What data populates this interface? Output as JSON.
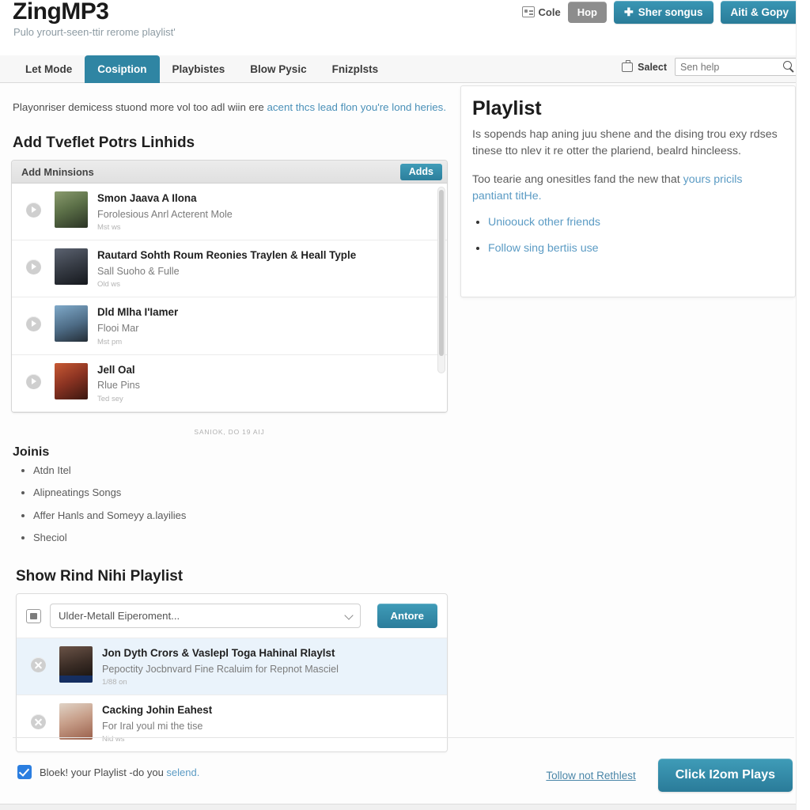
{
  "header": {
    "brand": "ZingMP3",
    "tagline": "Pulo yrourt-seen-ttir rerome playlist'",
    "chip_label": "Cole",
    "chip_icon": "card-icon",
    "btn_hop": "Hop",
    "btn_share": "Sher songus",
    "btn_share_icon": "plus-icon",
    "btn_copy": "Aiti & Gopy"
  },
  "nav": {
    "tabs": [
      {
        "label": "Let Mode",
        "active": false
      },
      {
        "label": "Cosiption",
        "active": true
      },
      {
        "label": "Playbistes",
        "active": false
      },
      {
        "label": "Blow Pysic",
        "active": false
      },
      {
        "label": "Fnizplsts",
        "active": false
      }
    ],
    "select_label": "Salect",
    "select_icon": "monitor-icon",
    "search_value": "",
    "search_placeholder": "Sen help",
    "search_icon": "search-icon"
  },
  "main": {
    "intro_text_1": "Playonriser demicess stuond more vol too adl wiin ere ",
    "intro_link": "acent thcs lead flon you're lond heries.",
    "section_title": "Add Tveflet Potrs Linhids",
    "panel": {
      "head_title": "Add Mninsions",
      "head_button": "Adds",
      "songs": [
        {
          "title": "Smon Jaava A Ilona",
          "subtitle": "Forolesious Anrl Acterent Mole",
          "meta": "Mst ws",
          "thumb_colors": [
            "#6d7f55",
            "#2f3b2a"
          ],
          "action_icon": "play-icon"
        },
        {
          "title": "Rautard Sohth Roum Reonies Traylen & Heall Typle",
          "subtitle": "Sall Suoho & Fulle",
          "meta": "Old ws",
          "thumb_colors": [
            "#3a3f4a",
            "#14171c"
          ],
          "action_icon": "play-icon"
        },
        {
          "title": "Dld Mlha I'Iamer",
          "subtitle": "Flooi Mar",
          "meta": "Mst pm",
          "thumb_colors": [
            "#5d86a8",
            "#26313c"
          ],
          "action_icon": "play-icon"
        },
        {
          "title": "Jell Oal",
          "subtitle": "Rlue Pins",
          "meta": "Ted sey",
          "thumb_colors": [
            "#a8442c",
            "#3c1a12"
          ],
          "action_icon": "play-icon"
        }
      ]
    },
    "center_note": "SANIOK,  DO 19 AIJ",
    "joins_title": "Joinis",
    "joins_items": [
      "Atdn Itel",
      "Alipneatings Songs",
      "Affer Hanls and Someyy a.layilies",
      "Sheciol"
    ],
    "show_title": "Show Rind Nihi Playlist",
    "form": {
      "left_icon": "image-box-icon",
      "select_value": "Ulder-Metall Eiperoment...",
      "select_options": [
        "Ulder-Metall Eiperoment..."
      ],
      "dropdown_icon": "chevron-down-icon",
      "store_button": "Antore",
      "rows": [
        {
          "title": "Jon Dyth Crors & Vaslepl Toga Hahinal Rlaylst",
          "subtitle": "Pepoctity Jocbnvard Fine Rcaluim for Repnot Masciel",
          "meta": "1/88 on",
          "selected": true,
          "thumb_colors": [
            "#4a3a34",
            "#13100e"
          ],
          "action_icon": "close-icon"
        },
        {
          "title": "Cacking Johin Eahest",
          "subtitle": "For Iral youl mi the tise",
          "meta": "Nid ws",
          "selected": false,
          "thumb_colors": [
            "#c9b8ab",
            "#8a5a48"
          ],
          "action_icon": "close-icon"
        }
      ]
    }
  },
  "right_panel": {
    "title": "Playlist",
    "paragraph_1": "Is sopends hap aning juu shene and the dising trou exy rdses tinese tto nlev it re otter the plariend, bealrd hincleess.",
    "paragraph_2_text": "Too tearie ang onesitles fand the new that ",
    "paragraph_2_link": "yours pricils pantiant titHe.",
    "links": [
      "Unioouck other friends",
      "Follow sing bertiis use"
    ]
  },
  "footer": {
    "checkbox_checked": true,
    "checkbox_label_1": "Bloek! your Playlist -do you ",
    "checkbox_label_link": "selend.",
    "link": "Tollow not Rethlest",
    "primary_button": "Click I2om Plays"
  },
  "colors": {
    "teal": "#2f85a3",
    "teal_light": "#3f9cb8",
    "link_blue": "#5b9bc4",
    "gray_button": "#8d8d8d",
    "checkbox_blue": "#2b7ee0",
    "selected_row": "#eaf3fb"
  }
}
